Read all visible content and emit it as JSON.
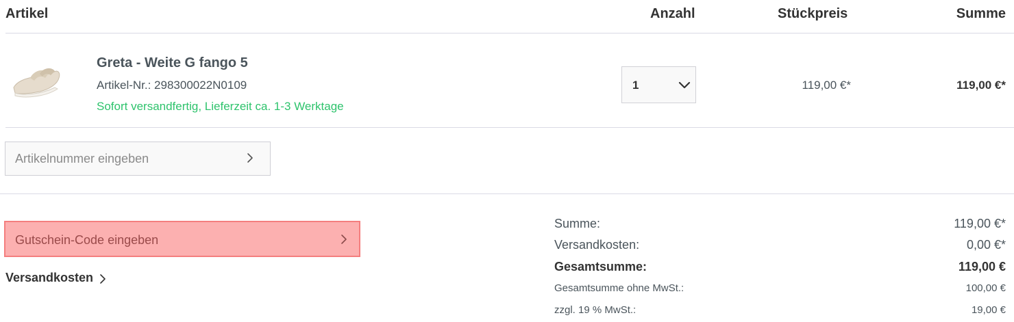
{
  "header": {
    "col_article": "Artikel",
    "col_quantity": "Anzahl",
    "col_unit_price": "Stückpreis",
    "col_sum": "Summe"
  },
  "item": {
    "name": "Greta - Weite G fango 5",
    "article_number": "Artikel-Nr.: 298300022N0109",
    "delivery": "Sofort versandfertig, Lieferzeit ca. 1-3 Werktage",
    "quantity": "1",
    "unit_price": "119,00 €*",
    "sum": "119,00 €*",
    "image_icon": "sandal-image"
  },
  "article_input": {
    "placeholder": "Artikelnummer eingeben"
  },
  "coupon_input": {
    "placeholder": "Gutschein-Code eingeben"
  },
  "shipping_link": {
    "label": "Versandkosten"
  },
  "summary": {
    "sum_label": "Summe:",
    "sum_value": "119,00 €*",
    "shipping_label": "Versandkosten:",
    "shipping_value": "0,00 €*",
    "total_label": "Gesamtsumme:",
    "total_value": "119,00 €",
    "net_label": "Gesamtsumme ohne MwSt.:",
    "net_value": "100,00 €",
    "vat_label": "zzgl. 19 % MwSt.:",
    "vat_value": "19,00 €"
  },
  "colors": {
    "delivery_green": "#2ec36c",
    "coupon_highlight": "#fcb0b0",
    "text": "#333333"
  }
}
